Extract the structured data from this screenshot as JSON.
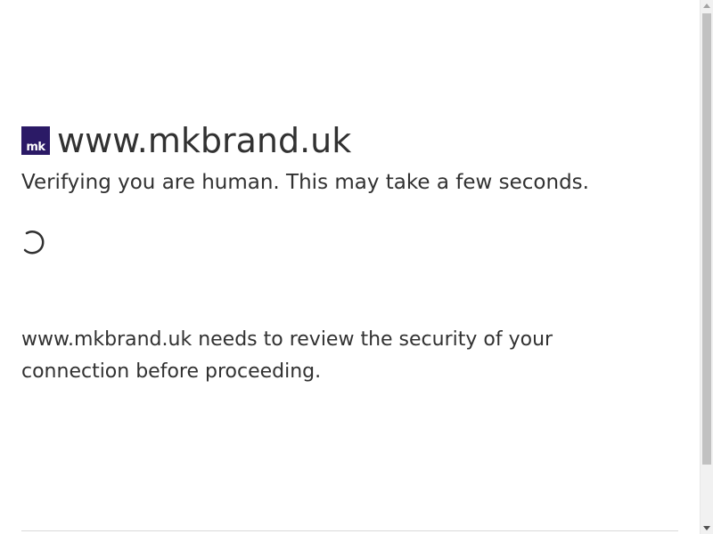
{
  "header": {
    "favicon_text": "mk",
    "site_name": "www.mkbrand.uk",
    "subtitle": "Verifying you are human. This may take a few seconds."
  },
  "main": {
    "message": "www.mkbrand.uk needs to review the security of your connection before proceeding."
  },
  "icons": {
    "favicon": "site-favicon-icon",
    "spinner": "loading-spinner-icon"
  },
  "colors": {
    "favicon_background": "#2b1a66",
    "text": "#313131",
    "background": "#ffffff"
  }
}
